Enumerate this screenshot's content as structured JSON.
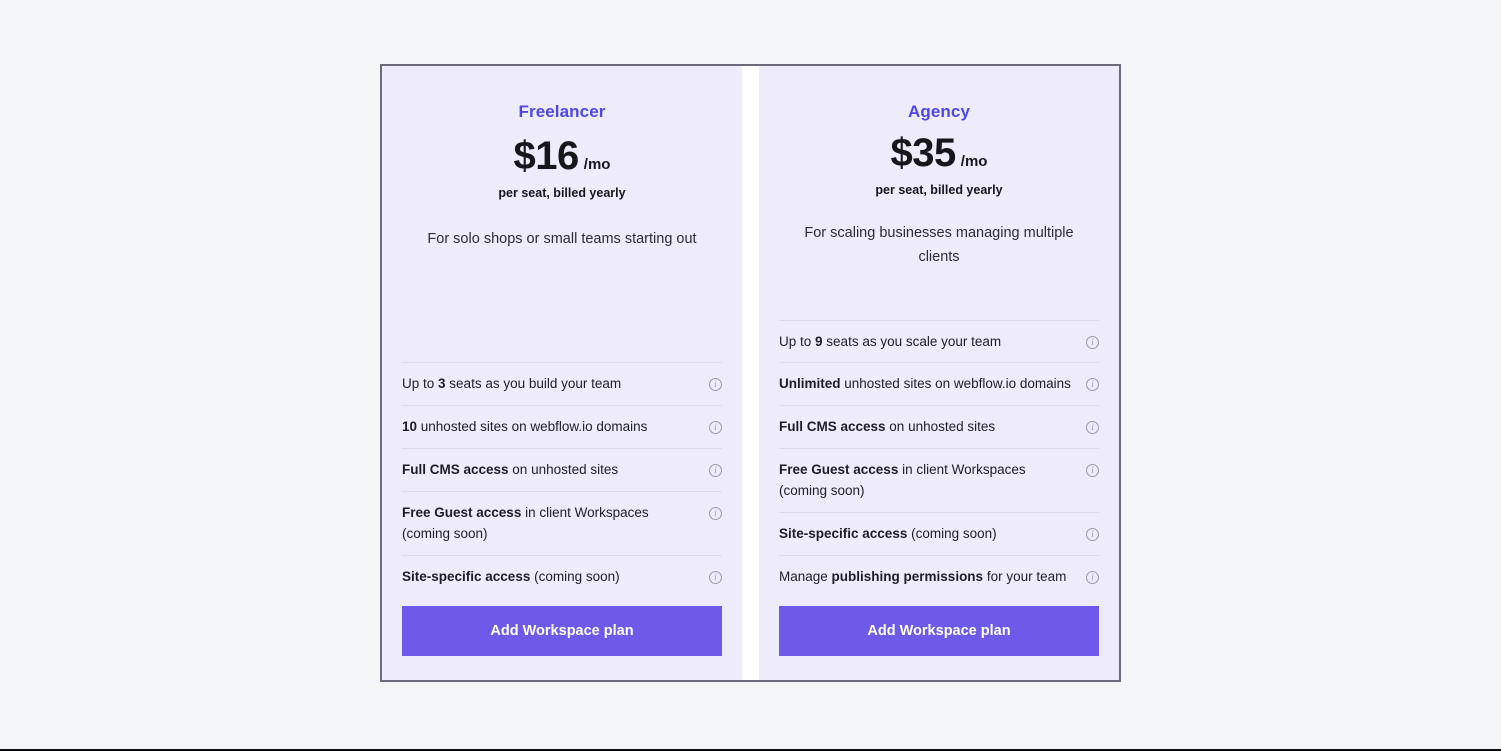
{
  "plans": [
    {
      "name": "Freelancer",
      "price": "$16",
      "period": "/mo",
      "billing_note": "per seat, billed yearly",
      "description": "For solo shops or small teams starting out",
      "features": [
        {
          "pre": "Up to ",
          "bold": "3",
          "post": " seats as you build your team",
          "info": "i"
        },
        {
          "pre": "",
          "bold": "10",
          "post": " unhosted sites on webflow.io domains",
          "info": "i"
        },
        {
          "pre": "",
          "bold": "Full CMS access",
          "post": " on unhosted sites",
          "info": "i"
        },
        {
          "pre": "",
          "bold": "Free Guest access",
          "post": " in client Workspaces (coming soon)",
          "info": "i"
        },
        {
          "pre": "",
          "bold": "Site-specific access",
          "post": " (coming soon)",
          "info": "i"
        }
      ],
      "cta_label": "Add Workspace plan"
    },
    {
      "name": "Agency",
      "price": "$35",
      "period": "/mo",
      "billing_note": "per seat, billed yearly",
      "description": "For scaling businesses managing multiple clients",
      "features": [
        {
          "pre": "Up to ",
          "bold": "9",
          "post": " seats as you scale your team",
          "info": "i"
        },
        {
          "pre": "",
          "bold": "Unlimited",
          "post": " unhosted sites on webflow.io domains",
          "info": "i"
        },
        {
          "pre": "",
          "bold": "Full CMS access",
          "post": " on unhosted sites",
          "info": "i"
        },
        {
          "pre": "",
          "bold": "Free Guest access",
          "post": " in client Workspaces (coming soon)",
          "info": "i"
        },
        {
          "pre": "",
          "bold": "Site-specific access",
          "post": " (coming soon)",
          "info": "i"
        },
        {
          "pre": "Manage ",
          "bold": "publishing permissions",
          "post": " for your team",
          "info": "i"
        }
      ],
      "cta_label": "Add Workspace plan"
    }
  ],
  "colors": {
    "accent": "#4f46e5",
    "cta_background": "#6d5ae8",
    "card_background": "#eeecfb",
    "page_background": "#f4f5f7",
    "frame_border": "#6b6b7b",
    "divider": "#dedbf0"
  }
}
